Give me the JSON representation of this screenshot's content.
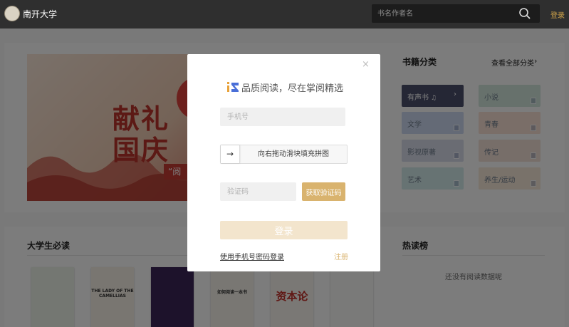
{
  "header": {
    "site_name": "南开大学",
    "search_placeholder": "书名作者名",
    "login_label": "登录"
  },
  "banner": {
    "line1": "献礼",
    "line2": "国庆",
    "ribbon": "“阅"
  },
  "categories": {
    "title": "书籍分类",
    "all_label": "查看全部分类",
    "items": [
      {
        "label": "有声书",
        "color": "#4a4f6b"
      },
      {
        "label": "小说",
        "color": "#cfe3d8"
      },
      {
        "label": "文学",
        "color": "#c9d4ec"
      },
      {
        "label": "青春",
        "color": "#f4ddd0"
      },
      {
        "label": "影视原著",
        "color": "#d4d8e6"
      },
      {
        "label": "传记",
        "color": "#eedcd3"
      },
      {
        "label": "艺术",
        "color": "#cfe6e6"
      },
      {
        "label": "养生/运动",
        "color": "#f2e4d4"
      }
    ]
  },
  "sections": {
    "must_read": "大学生必读",
    "hot_list": "热读榜",
    "empty_hot": "还没有阅读数据呢"
  },
  "books": [
    {
      "color": "#e9efe4",
      "text": ""
    },
    {
      "color": "#f3ede2",
      "text": "THE LADY OF THE CAMELLIAS"
    },
    {
      "color": "#3b2456",
      "text": ""
    },
    {
      "color": "#f2efe6",
      "text": "如何阅读一本书"
    },
    {
      "color": "#f4f1ea",
      "text": "资本论"
    },
    {
      "color": "#f5f5f2",
      "text": ""
    }
  ],
  "modal": {
    "slogan": "品质阅读，尽在掌阅精选",
    "phone_placeholder": "手机号",
    "slider_text": "向右拖动滑块填充拼图",
    "slider_arrow": "→",
    "code_placeholder": "验证码",
    "get_code_label": "获取验证码",
    "login_label": "登录",
    "password_login_link": "使用手机号密码登录",
    "register_link": "注册",
    "close_glyph": "×"
  },
  "colors": {
    "accent": "#d9b36e",
    "topbar": "#2f2f2f"
  }
}
